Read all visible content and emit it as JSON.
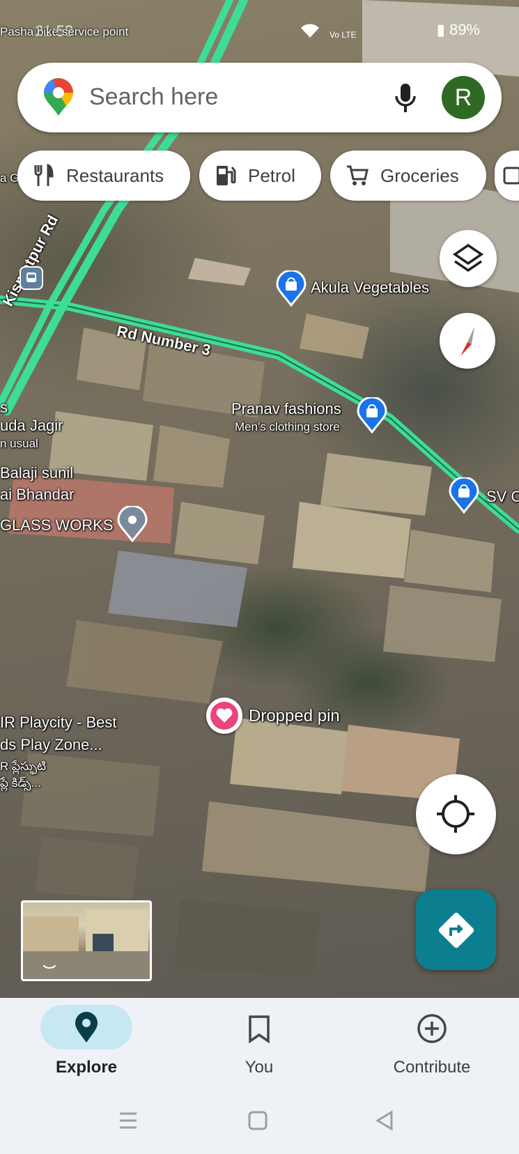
{
  "status_bar": {
    "time": "21:58",
    "battery": "89%",
    "network": "Vo LTE"
  },
  "top_place": "Pasha bike service point",
  "search": {
    "placeholder": "Search here",
    "avatar_letter": "R"
  },
  "chips": [
    {
      "label": "Restaurants",
      "icon": "fork-knife-icon"
    },
    {
      "label": "Petrol",
      "icon": "fuel-pump-icon"
    },
    {
      "label": "Groceries",
      "icon": "cart-icon"
    }
  ],
  "map": {
    "roads": [
      "Kismatpur Rd",
      "Rd Number 3"
    ],
    "places": {
      "akula": "Akula Vegetables",
      "pranav": "Pranav fashions",
      "pranav_sub": "Men's clothing store",
      "sv": "SV C",
      "guda": "uda Jagir",
      "usual": "n usual",
      "balaji": "Balaji sunil",
      "bhandar": "ai Bhandar",
      "glass": "GLASS WORKS",
      "ir1": "IR Playcity - Best",
      "ir2": "ds Play Zone...",
      "ir3": "R ప్లేస్ఫుటి",
      "ir4": "ప్లే కిడ్స్...",
      "s": "s",
      "a_g": "a G"
    },
    "dropped_pin": "Dropped pin"
  },
  "colors": {
    "road": "#3ddc97",
    "accent": "#0b7f8f",
    "pin_blue": "#1a73e8",
    "pin_pink": "#e8457a"
  },
  "bottom_nav": [
    {
      "label": "Explore",
      "icon": "location-pin-icon",
      "active": true
    },
    {
      "label": "You",
      "icon": "bookmark-icon",
      "active": false
    },
    {
      "label": "Contribute",
      "icon": "add-circle-icon",
      "active": false
    }
  ]
}
